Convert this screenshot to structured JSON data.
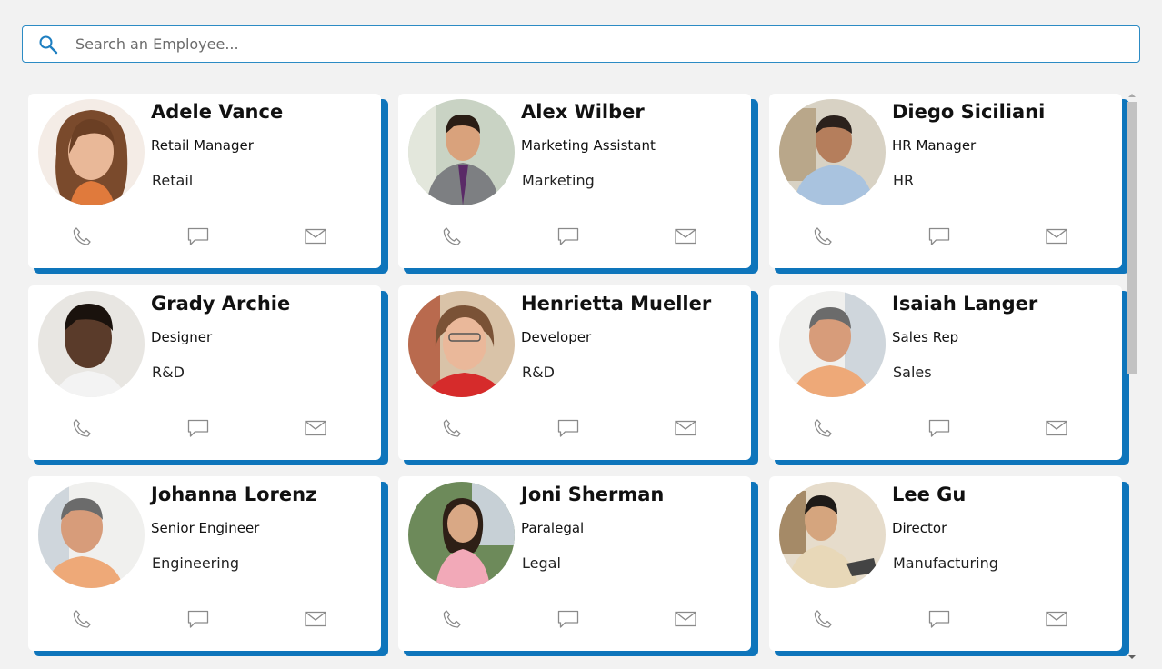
{
  "search": {
    "placeholder": "Search an Employee...",
    "value": ""
  },
  "colors": {
    "accent": "#0e75bb",
    "search_border": "#2c8bc4",
    "icon_gray": "#8a8a8a",
    "background": "#f2f2f2"
  },
  "actions": {
    "phone_icon": "phone-icon",
    "chat_icon": "chat-icon",
    "mail_icon": "mail-icon"
  },
  "employees": [
    {
      "name": "Adele Vance",
      "title": "Retail Manager",
      "department": "Retail"
    },
    {
      "name": "Alex Wilber",
      "title": "Marketing Assistant",
      "department": "Marketing"
    },
    {
      "name": "Diego Siciliani",
      "title": "HR Manager",
      "department": "HR"
    },
    {
      "name": "Grady Archie",
      "title": "Designer",
      "department": "R&D"
    },
    {
      "name": "Henrietta Mueller",
      "title": "Developer",
      "department": "R&D"
    },
    {
      "name": "Isaiah Langer",
      "title": "Sales Rep",
      "department": "Sales"
    },
    {
      "name": "Johanna Lorenz",
      "title": "Senior Engineer",
      "department": "Engineering"
    },
    {
      "name": "Joni Sherman",
      "title": "Paralegal",
      "department": "Legal"
    },
    {
      "name": "Lee Gu",
      "title": "Director",
      "department": "Manufacturing"
    }
  ]
}
